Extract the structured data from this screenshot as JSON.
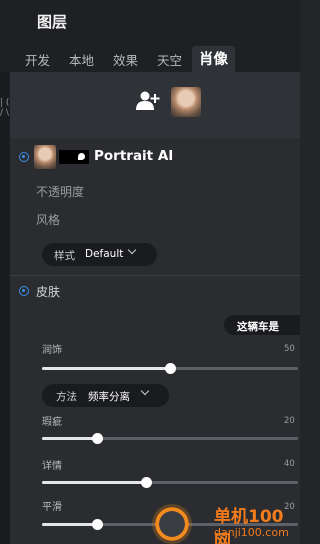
{
  "header": {
    "title": "图层"
  },
  "tabs": [
    {
      "label": "开发"
    },
    {
      "label": "本地"
    },
    {
      "label": "效果"
    },
    {
      "label": "天空"
    },
    {
      "label": "肖像",
      "active": true
    }
  ],
  "left_rail": {
    "text": "| ( / \\"
  },
  "layers": {
    "add_icon": "add-person-icon",
    "layer_name": "Portrait AI",
    "opacity_label": "不透明度",
    "style_label": "风格",
    "style_dropdown": {
      "key": "样式",
      "value": "Default"
    }
  },
  "skin": {
    "section_label": "皮肤",
    "badge": "这辆车是",
    "retouch": {
      "label": "润饰",
      "value": 50,
      "fraction": 0.5
    },
    "method_dropdown": {
      "key": "方法",
      "value": "频率分离"
    },
    "blemish": {
      "label": "瑕疵",
      "value": 20,
      "fraction": 0.215
    },
    "detail": {
      "label": "详情",
      "value": 40,
      "fraction": 0.408
    },
    "smooth": {
      "label": "平滑",
      "value": 20,
      "fraction": 0.215
    }
  },
  "watermark": {
    "line1": "单机100网",
    "line2": "danji100.com"
  },
  "colors": {
    "accent": "#3d8ef0",
    "watermark": "#f27c1c",
    "panel": "#2a2c30"
  }
}
